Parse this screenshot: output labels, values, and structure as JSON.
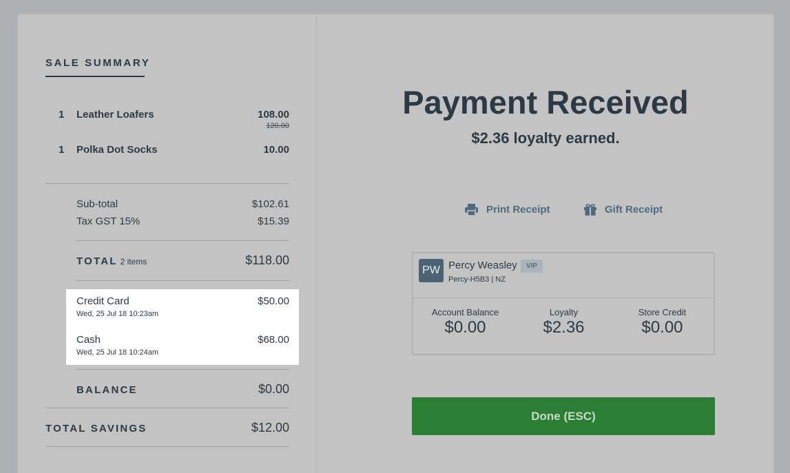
{
  "summary": {
    "title": "SALE SUMMARY",
    "items": [
      {
        "qty": "1",
        "name": "Leather Loafers",
        "price": "108.00",
        "original_price": "120.00"
      },
      {
        "qty": "1",
        "name": "Polka Dot Socks",
        "price": "10.00"
      }
    ],
    "subtotal_label": "Sub-total",
    "subtotal_value": "$102.61",
    "tax_label": "Tax GST 15%",
    "tax_value": "$15.39",
    "total_label": "TOTAL",
    "total_items": "2 items",
    "total_value": "$118.00",
    "payments": [
      {
        "method": "Credit Card",
        "amount": "$50.00",
        "time": "Wed, 25 Jul 18 10:23am"
      },
      {
        "method": "Cash",
        "amount": "$68.00",
        "time": "Wed, 25 Jul 18 10:24am"
      }
    ],
    "balance_label": "BALANCE",
    "balance_value": "$0.00",
    "savings_label": "TOTAL SAVINGS",
    "savings_value": "$12.00"
  },
  "result": {
    "headline": "Payment Received",
    "loyalty_earned": "$2.36 loyalty earned.",
    "print_receipt": "Print Receipt",
    "gift_receipt": "Gift Receipt"
  },
  "customer": {
    "initials": "PW",
    "name": "Percy Weasley",
    "badge": "VIP",
    "code": "Percy-H5B3 | NZ",
    "stats": [
      {
        "label": "Account Balance",
        "value": "$0.00"
      },
      {
        "label": "Loyalty",
        "value": "$2.36"
      },
      {
        "label": "Store Credit",
        "value": "$0.00"
      }
    ]
  },
  "done_label": "Done (ESC)",
  "colors": {
    "accent_green": "#2b7e33",
    "link_blue": "#4d6a82",
    "text_dark": "#2b3a44"
  }
}
